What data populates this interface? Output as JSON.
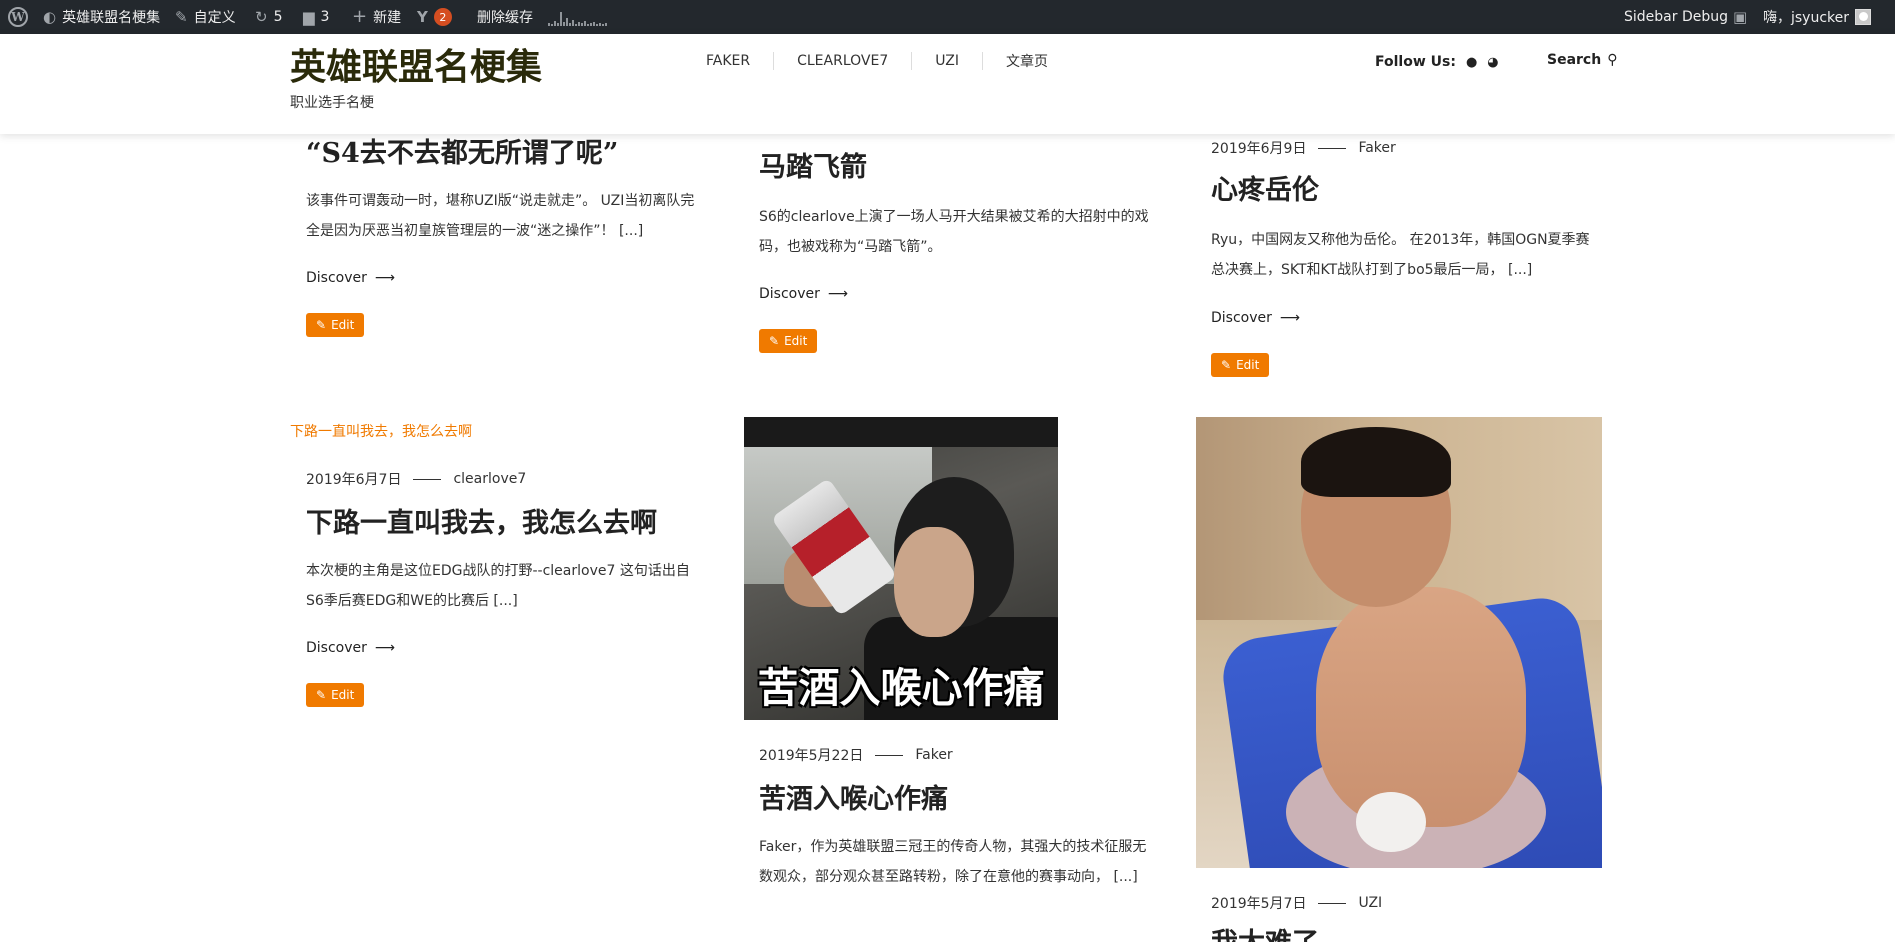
{
  "adminbar": {
    "site_name": "英雄联盟名梗集",
    "customize": "自定义",
    "updates_count": "5",
    "comments_count": "3",
    "new_label": "新建",
    "yoast_badge": "2",
    "clear_cache": "删除缓存",
    "sidebar_debug": "Sidebar Debug",
    "greeting": "嗨，jsyucker"
  },
  "header": {
    "site_title": "英雄联盟名梗集",
    "site_description": "职业选手名梗",
    "nav": [
      "FAKER",
      "CLEARLOVE7",
      "UZI",
      "文章页"
    ],
    "follow_label": "Follow Us:",
    "search_label": "Search"
  },
  "posts": {
    "p1": {
      "title": "“S4去不去都无所谓了呢”",
      "excerpt": "该事件可谓轰动一时，堪称UZI版“说走就走”。 UZI当初离队完全是因为厌恶当初皇族管理层的一波“迷之操作”！ [...]",
      "discover": "Discover",
      "edit": "Edit"
    },
    "p2": {
      "title": "马踏飞箭",
      "excerpt": "S6的clearlove上演了一场人马开大结果被艾希的大招射中的戏码，也被戏称为“马踏飞箭”。",
      "discover": "Discover",
      "edit": "Edit"
    },
    "p3": {
      "date": "2019年6月9日",
      "author": "Faker",
      "title": "心疼岳伦",
      "excerpt": "Ryu，中国网友又称他为岳伦。 在2013年，韩国OGN夏季赛总决赛上，SKT和KT战队打到了bo5最后一局， [...]",
      "discover": "Discover",
      "edit": "Edit"
    },
    "p4": {
      "category": "下路一直叫我去，我怎么去啊",
      "date": "2019年6月7日",
      "author": "clearlove7",
      "title": "下路一直叫我去，我怎么去啊",
      "excerpt": "本次梗的主角是这位EDG战队的打野--clearlove7 这句话出自S6季后赛EDG和WE的比赛后 [...]",
      "discover": "Discover",
      "edit": "Edit"
    },
    "p5": {
      "image_caption": "苦酒入喉心作痛",
      "date": "2019年5月22日",
      "author": "Faker",
      "title": "苦酒入喉心作痛",
      "excerpt": "Faker，作为英雄联盟三冠王的传奇人物，其强大的技术征服无数观众，部分观众甚至路转粉，除了在意他的赛事动向， [...]"
    },
    "p6": {
      "date": "2019年5月7日",
      "author": "UZI",
      "title": "我太难了"
    }
  },
  "colors": {
    "accent": "#f07a00",
    "adminbar_bg": "#23282d",
    "title_color": "#2a2a0a"
  }
}
